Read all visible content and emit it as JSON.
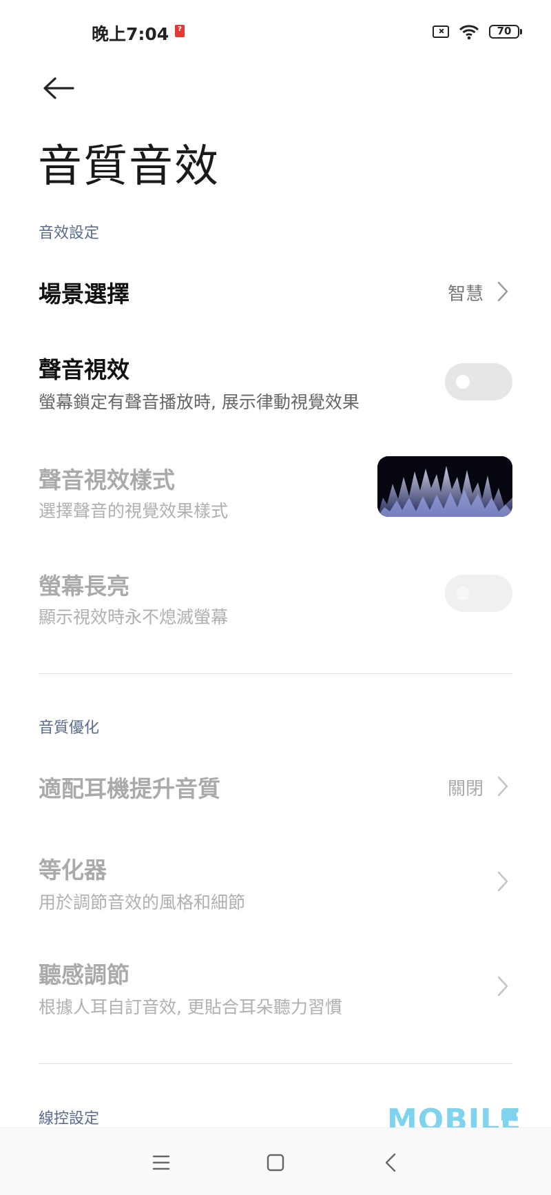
{
  "status_bar": {
    "time": "晚上7:04",
    "notification_icon": "app-notification-icon",
    "battery": "70"
  },
  "header": {
    "back_icon": "arrow-left-icon",
    "title": "音質音效"
  },
  "sections": {
    "sound_effect": {
      "header": "音效設定",
      "scene": {
        "title": "場景選擇",
        "value": "智慧"
      },
      "visual": {
        "title": "聲音視效",
        "subtitle": "螢幕鎖定有聲音播放時, 展示律動視覺效果",
        "enabled": false
      },
      "visual_style": {
        "title": "聲音視效樣式",
        "subtitle": "選擇聲音的視覺效果樣式"
      },
      "screen_on": {
        "title": "螢幕長亮",
        "subtitle": "顯示視效時永不熄滅螢幕",
        "enabled": false
      }
    },
    "quality": {
      "header": "音質優化",
      "headphone": {
        "title": "適配耳機提升音質",
        "value": "關閉"
      },
      "equalizer": {
        "title": "等化器",
        "subtitle": "用於調節音效的風格和細節"
      },
      "hearing": {
        "title": "聽感調節",
        "subtitle": "根據人耳自訂音效, 更貼合耳朵聽力習慣"
      }
    },
    "wired": {
      "header": "線控設定"
    }
  },
  "nav": {
    "menu_icon": "menu-icon",
    "home_icon": "home-icon",
    "back_icon": "back-icon"
  },
  "watermark": "MOBILE"
}
